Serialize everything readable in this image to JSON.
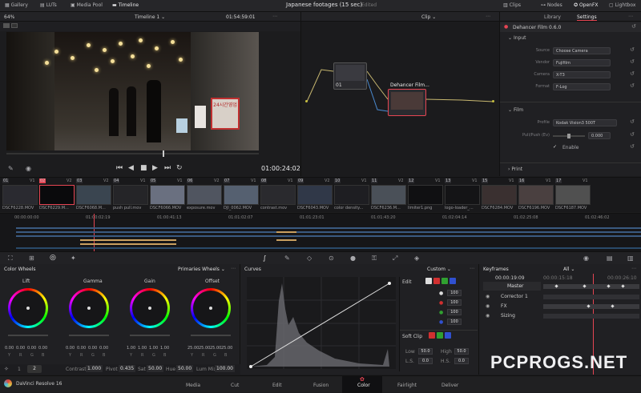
{
  "topbar": {
    "gallery": "Gallery",
    "luts": "LUTs",
    "media_pool": "Media Pool",
    "timeline": "Timeline",
    "project_title": "Japanese footages (15 sec)",
    "edited": "Edited",
    "clips": "Clips",
    "nodes": "Nodes",
    "openfx": "OpenFX",
    "lightbox": "Lightbox"
  },
  "viewer": {
    "zoom": "64%",
    "timeline_name": "Timeline 1",
    "timecode_top": "01:54:59:01",
    "timecode": "01:00:24:02",
    "sign1": "24시간영업",
    "sign2": "24"
  },
  "nodes": {
    "mode": "Clip",
    "node1_label": "01",
    "node2_label": "Dehancer Film..."
  },
  "inspector": {
    "tab_library": "Library",
    "tab_settings": "Settings",
    "plugin": "Dehancer Film 0.6.0",
    "input_section": "Input",
    "source_label": "Source",
    "source_value": "Choose Camera",
    "vendor_label": "Vendor",
    "vendor_value": "Fujifilm",
    "camera_label": "Camera",
    "camera_value": "X-T3",
    "format_label": "Format",
    "format_value": "F-Log",
    "film_section": "Film",
    "profile_label": "Profile",
    "profile_value": "Kodak Vision3 500T",
    "pullpush_label": "Pull/Push (Ev)",
    "pullpush_value": "0.000",
    "enable_label": "Enable",
    "print_section": "Print"
  },
  "clips": [
    {
      "num": "01",
      "track": "V1",
      "name": "DSCF6228.MOV"
    },
    {
      "num": "02",
      "track": "V2",
      "name": "DSCF6229.M..."
    },
    {
      "num": "03",
      "track": "V2",
      "name": "DSCF6068.M..."
    },
    {
      "num": "04",
      "track": "V1",
      "name": "push pull.mov"
    },
    {
      "num": "05",
      "track": "V1",
      "name": "DSCF6066.MOV"
    },
    {
      "num": "06",
      "track": "V2",
      "name": "exposure.mov"
    },
    {
      "num": "07",
      "track": "V1",
      "name": "DJI_0062.MOV"
    },
    {
      "num": "08",
      "track": "V1",
      "name": "contrast.mov"
    },
    {
      "num": "09",
      "track": "V2",
      "name": "DSCF6043.MOV"
    },
    {
      "num": "10",
      "track": "V1",
      "name": "color density..."
    },
    {
      "num": "11",
      "track": "V2",
      "name": "DSCF6236.M..."
    },
    {
      "num": "12",
      "track": "V1",
      "name": "limiter1.png"
    },
    {
      "num": "13",
      "track": "V1",
      "name": "logo-loader_..."
    },
    {
      "num": "15",
      "track": "V1",
      "name": "DSCF6284.MOV"
    },
    {
      "num": "16",
      "track": "V1",
      "name": "DSCF6196.MOV"
    },
    {
      "num": "17",
      "track": "V1",
      "name": "DSCF6187.MOV"
    }
  ],
  "ruler": [
    "00:00:00:00",
    "01:00:02:19",
    "01:00:41:13",
    "01:01:02:07",
    "01:01:23:01",
    "01:01:43:20",
    "01:02:04:14",
    "01:02:25:08",
    "01:02:46:02"
  ],
  "color_wheels": {
    "title": "Color Wheels",
    "mode": "Primaries Wheels",
    "wheels": [
      {
        "name": "Lift",
        "vals": [
          "0.00",
          "0.00",
          "0.00",
          "0.00"
        ]
      },
      {
        "name": "Gamma",
        "vals": [
          "0.00",
          "0.00",
          "0.00",
          "0.00"
        ]
      },
      {
        "name": "Gain",
        "vals": [
          "1.00",
          "1.00",
          "1.00",
          "1.00"
        ]
      },
      {
        "name": "Offset",
        "vals": [
          "25.00",
          "25.00",
          "25.00",
          "25.00"
        ]
      }
    ],
    "channels": [
      "Y",
      "R",
      "G",
      "B"
    ],
    "contrast_label": "Contrast",
    "contrast": "1.000",
    "pivot_label": "Pivot",
    "pivot": "0.435",
    "sat_label": "Sat",
    "sat": "50.00",
    "hue_label": "Hue",
    "hue": "50.00",
    "lummix_label": "Lum Mix",
    "lummix": "100.00",
    "page1": "1",
    "page2": "2"
  },
  "curves": {
    "title": "Curves",
    "mode": "Custom",
    "edit": "Edit",
    "values": [
      "100",
      "100",
      "100",
      "100"
    ],
    "soft_clip": "Soft Clip",
    "low_label": "Low",
    "low": "50.0",
    "high_label": "High",
    "high": "50.0",
    "ls_label": "L.S.",
    "ls": "0.0",
    "hs_label": "H.S.",
    "hs": "0.0"
  },
  "keyframes": {
    "title": "Keyframes",
    "filter": "All",
    "timecode": "00:00:19:09",
    "tc2": "00:00:15:18",
    "tc3": "00:00:26:10",
    "rows": [
      "Master",
      "Corrector 1",
      "FX",
      "Sizing"
    ]
  },
  "bottom_nav": {
    "app": "DaVinci Resolve 16",
    "media": "Media",
    "cut": "Cut",
    "edit": "Edit",
    "fusion": "Fusion",
    "color": "Color",
    "fairlight": "Fairlight",
    "deliver": "Deliver"
  },
  "watermark": "PCPROGS.NET",
  "colors": {
    "accent": "#e64553",
    "active_tab": "#e8e8ea"
  }
}
